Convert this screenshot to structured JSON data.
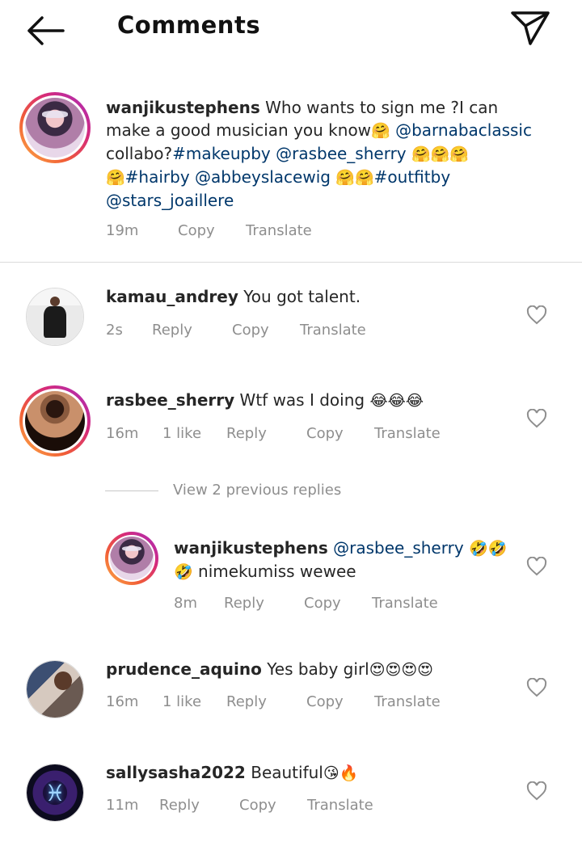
{
  "header": {
    "title": "Comments",
    "back_icon": "back-arrow-icon",
    "send_icon": "send-paper-plane-icon"
  },
  "caption": {
    "username": "wanjikustephens",
    "text_1": "Who wants to sign me ?I can make a good  musician you know",
    "mention_1": "@barnabaclassic",
    "text_2": "collabo?",
    "hashtag_1": "#makeupby",
    "mention_2": "@rasbee_sherry",
    "hashtag_2": "#hairby",
    "mention_3": "@abbeyslacewig",
    "hashtag_3": "#outfitby",
    "mention_4": "@stars_joaillere",
    "emoji_hug": "🤗",
    "time": "19m",
    "copy": "Copy",
    "translate": "Translate"
  },
  "comments": [
    {
      "username": "kamau_andrey",
      "text": "You got talent.",
      "time": "2s",
      "reply": "Reply",
      "copy": "Copy",
      "translate": "Translate"
    },
    {
      "username": "rasbee_sherry",
      "text": "Wtf was I doing",
      "emoji": "😂😂😂",
      "time": "16m",
      "likes": "1 like",
      "reply": "Reply",
      "copy": "Copy",
      "translate": "Translate"
    },
    {
      "username": "prudence_aquino",
      "text": "Yes baby girl",
      "emoji": "😍😍😍😍",
      "time": "16m",
      "likes": "1 like",
      "reply": "Reply",
      "copy": "Copy",
      "translate": "Translate"
    },
    {
      "username": "sallysasha2022",
      "text": "Beautiful",
      "emoji": "😘🔥",
      "time": "11m",
      "reply": "Reply",
      "copy": "Copy",
      "translate": "Translate"
    }
  ],
  "view_replies": "View 2 previous replies",
  "reply": {
    "username": "wanjikustephens",
    "mention": "@rasbee_sherry",
    "emoji_1": "🤣🤣",
    "emoji_2": "🤣",
    "text": "nimekumiss wewee",
    "time": "8m",
    "reply": "Reply",
    "copy": "Copy",
    "translate": "Translate"
  },
  "colors": {
    "mention": "#00376b",
    "meta": "#8e8e8e",
    "divider": "#dbdbdb"
  }
}
